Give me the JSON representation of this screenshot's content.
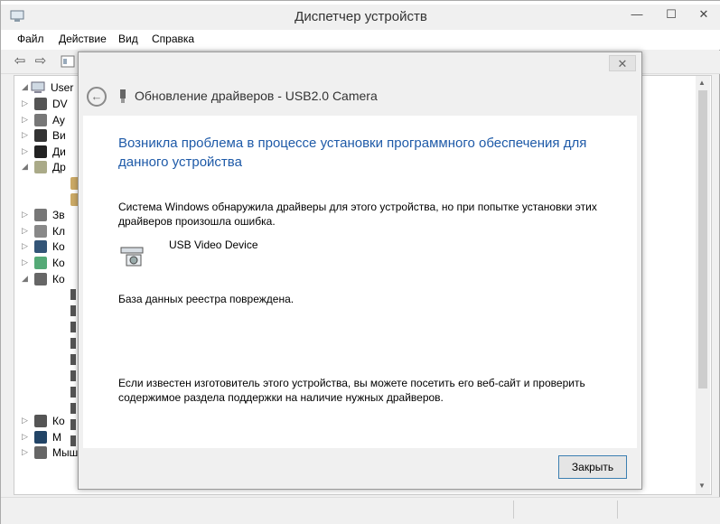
{
  "window": {
    "title": "Диспетчер устройств",
    "minimize": "—",
    "maximize": "☐",
    "close": "✕"
  },
  "menu": [
    "Файл",
    "Действие",
    "Вид",
    "Справка"
  ],
  "toolbar": {
    "back_icon": "back-arrow-icon",
    "forward_icon": "forward-arrow-icon"
  },
  "tree": {
    "root_label": "User",
    "items": [
      {
        "label": "DV",
        "arrow": "▷"
      },
      {
        "label": "Ау",
        "arrow": "▷"
      },
      {
        "label": "Ви",
        "arrow": "▷"
      },
      {
        "label": "Ди",
        "arrow": "▷"
      },
      {
        "label": "Др",
        "arrow": "◢"
      },
      {
        "label": "",
        "arrow": ""
      },
      {
        "label": "",
        "arrow": ""
      },
      {
        "label": "Зв",
        "arrow": "▷"
      },
      {
        "label": "Кл",
        "arrow": "▷"
      },
      {
        "label": "Ко",
        "arrow": "▷"
      },
      {
        "label": "Ко",
        "arrow": "▷"
      },
      {
        "label": "Ко",
        "arrow": "◢"
      },
      {
        "label": "Ко",
        "arrow": "▷"
      },
      {
        "label": "М",
        "arrow": "▷"
      },
      {
        "label": "Мыши и иные указывающие устройства",
        "arrow": "▷"
      }
    ]
  },
  "dialog": {
    "close": "✕",
    "back_icon": "←",
    "title": "Обновление драйверов - USB2.0 Camera",
    "error_heading": "Возникла проблема в процессе установки программного обеспечения для данного устройства",
    "message1": "Система Windows обнаружила драйверы для этого устройства, но при попытке установки этих драйверов произошла ошибка.",
    "device_name": "USB Video Device",
    "message2": "База данных реестра повреждена.",
    "message3": "Если известен изготовитель этого устройства, вы можете посетить его веб-сайт и проверить содержимое раздела поддержки на наличие нужных драйверов.",
    "close_button": "Закрыть"
  }
}
